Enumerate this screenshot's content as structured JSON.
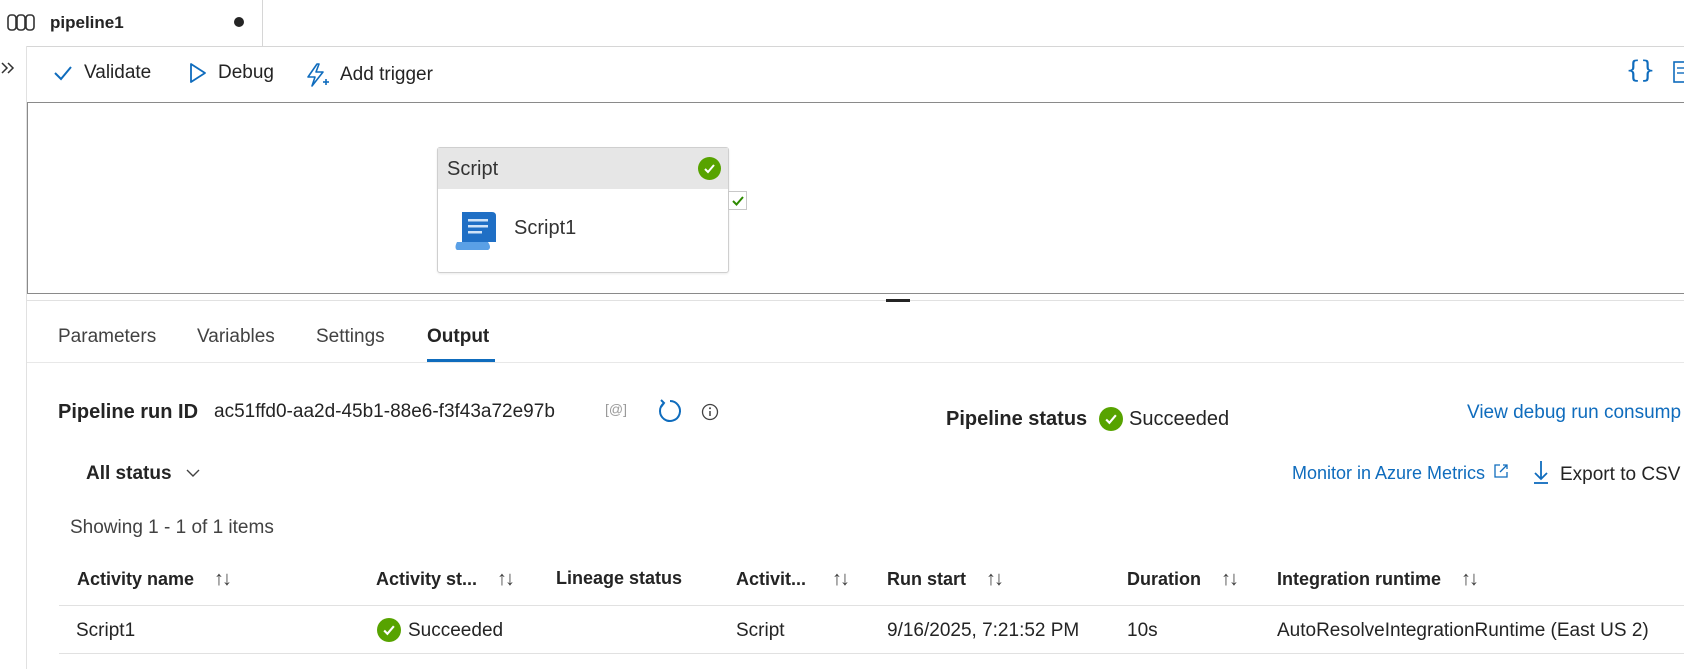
{
  "tab": {
    "title": "pipeline1"
  },
  "toolbar": {
    "validate_label": "Validate",
    "debug_label": "Debug",
    "add_trigger_label": "Add trigger",
    "code_icon_text": "{}"
  },
  "canvas": {
    "activity": {
      "type_label": "Script",
      "name": "Script1",
      "status": "succeeded"
    }
  },
  "panel_tabs": [
    {
      "label": "Parameters"
    },
    {
      "label": "Variables"
    },
    {
      "label": "Settings"
    },
    {
      "label": "Output",
      "active": true
    }
  ],
  "output": {
    "run_id_label": "Pipeline run ID",
    "run_id_value": "ac51ffd0-aa2d-45b1-88e6-f3f43a72e97b",
    "copy_icon_text": "[@]",
    "pipeline_status_label": "Pipeline status",
    "pipeline_status_value": "Succeeded",
    "view_debug_link": "View debug run consump",
    "status_filter": "All status",
    "monitor_link": "Monitor in Azure Metrics",
    "export_label": "Export to CSV",
    "showing_text": "Showing 1 - 1 of 1 items"
  },
  "table": {
    "columns": [
      {
        "label": "Activity name"
      },
      {
        "label": "Activity st..."
      },
      {
        "label": "Lineage status"
      },
      {
        "label": "Activit..."
      },
      {
        "label": "Run start"
      },
      {
        "label": "Duration"
      },
      {
        "label": "Integration runtime"
      }
    ],
    "rows": [
      {
        "activity_name": "Script1",
        "activity_status": "Succeeded",
        "lineage_status": "",
        "activity_type": "Script",
        "run_start": "9/16/2025, 7:21:52 PM",
        "duration": "10s",
        "integration_runtime": "AutoResolveIntegrationRuntime (East US 2)"
      }
    ]
  },
  "colors": {
    "accent": "#0f6cbd",
    "success": "#57a300",
    "link": "#0f6cbd"
  }
}
